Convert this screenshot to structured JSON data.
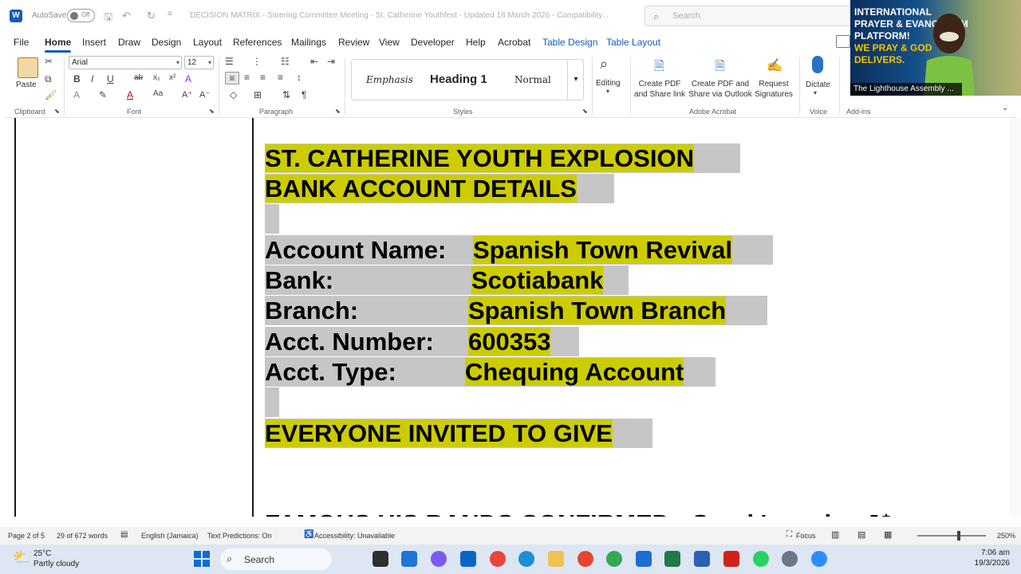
{
  "titlebar": {
    "autosave_label": "AutoSave",
    "autosave_state": "Off",
    "document_title": "DECISION MATRIX - Steering Committee Meeting - St. Catherine Youthfest - Updated 18 March 2026 - Compatibility...",
    "search_placeholder": "Search"
  },
  "tabs": [
    "File",
    "Home",
    "Insert",
    "Draw",
    "Design",
    "Layout",
    "References",
    "Mailings",
    "Review",
    "View",
    "Developer",
    "Help",
    "Acrobat",
    "Table Design",
    "Table Layout"
  ],
  "ribbon": {
    "paste_label": "Paste",
    "font_name": "Arial",
    "font_size": "12",
    "groups": {
      "clipboard": "Clipboard",
      "font": "Font",
      "paragraph": "Paragraph",
      "styles": "Styles",
      "adobe": "Adobe Acrobat",
      "voice": "Voice",
      "addins": "Add-ins"
    },
    "styles": [
      "Emphasis",
      "Heading 1",
      "Normal"
    ],
    "editing_label": "Editing",
    "create_pdf_share": "Create PDF and Share link",
    "create_pdf_outlook": "Create PDF and Share via Outlook",
    "request_signatures": "Request Signatures",
    "dictate_label": "Dictate"
  },
  "document": {
    "heading_line1": "ST. CATHERINE YOUTH EXPLOSION",
    "heading_line2": "BANK ACCOUNT DETAILS",
    "rows": [
      {
        "label": "Account Name:",
        "value": "Spanish Town Revival"
      },
      {
        "label": "Bank:",
        "value": "Scotiabank"
      },
      {
        "label": "Branch:",
        "value": "Spanish Town Branch"
      },
      {
        "label": "Acct. Number:",
        "value": "600353"
      },
      {
        "label": "Acct. Type:",
        "value": "Chequing Account"
      }
    ],
    "call_to_action": "EVERYONE INVITED TO GIVE",
    "cut_off_line": "FAMOUS HIS BANDS CONFIRMED - Spark's and ... J$"
  },
  "statusbar": {
    "page": "Page 2 of 5",
    "words": "29 of 672 words",
    "language": "English (Jamaica)",
    "text_predictions": "Text Predictions: On",
    "accessibility": "Accessibility: Unavailable",
    "focus": "Focus",
    "zoom": "250%"
  },
  "taskbar": {
    "temperature": "25°C",
    "weather": "Partly cloudy",
    "search_label": "Search",
    "time": "7:06 am",
    "date": "19/3/2026"
  },
  "video": {
    "banner_line1": "INTERNATIONAL",
    "banner_line2": "PRAYER & EVANGELISM",
    "banner_line3": "PLATFORM!",
    "banner_line4": "WE PRAY & GOD",
    "banner_line5": "DELIVERS.",
    "participant_name": "The Lighthouse Assembly ..."
  },
  "colors": {
    "highlight": "#cccc00",
    "selection_gray": "#c6c6c6",
    "word_blue": "#185abd",
    "taskbar": "#dde6f2"
  }
}
